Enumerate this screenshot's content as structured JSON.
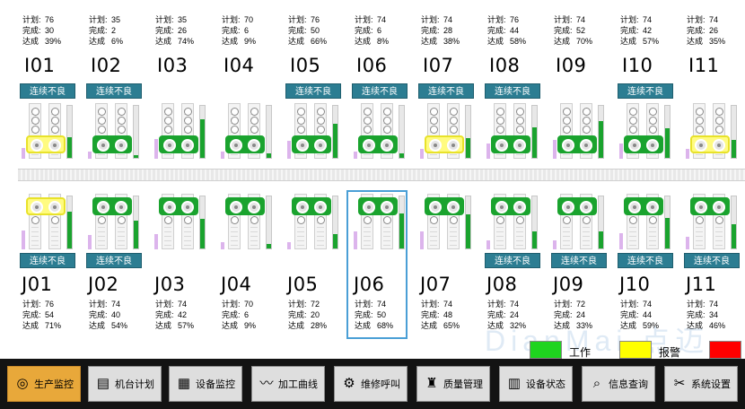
{
  "stat_keys": {
    "plan": "计划:",
    "done": "完成:",
    "rate": "达成"
  },
  "defect_label": "连续不良",
  "top_stations": [
    {
      "id": "I01",
      "plan": "76",
      "done": "30",
      "rate": "39%",
      "defect": true,
      "holder": "yellow",
      "fill": 0.39
    },
    {
      "id": "I02",
      "plan": "35",
      "done": "2",
      "rate": "6%",
      "defect": true,
      "holder": "green",
      "fill": 0.06
    },
    {
      "id": "I03",
      "plan": "35",
      "done": "26",
      "rate": "74%",
      "defect": false,
      "holder": "green",
      "fill": 0.74
    },
    {
      "id": "I04",
      "plan": "70",
      "done": "6",
      "rate": "9%",
      "defect": false,
      "holder": "green",
      "fill": 0.09
    },
    {
      "id": "I05",
      "plan": "76",
      "done": "50",
      "rate": "66%",
      "defect": true,
      "holder": "green",
      "fill": 0.66
    },
    {
      "id": "I06",
      "plan": "74",
      "done": "6",
      "rate": "8%",
      "defect": true,
      "holder": "green",
      "fill": 0.08
    },
    {
      "id": "I07",
      "plan": "74",
      "done": "28",
      "rate": "38%",
      "defect": true,
      "holder": "yellow",
      "fill": 0.38
    },
    {
      "id": "I08",
      "plan": "76",
      "done": "44",
      "rate": "58%",
      "defect": true,
      "holder": "green",
      "fill": 0.58
    },
    {
      "id": "I09",
      "plan": "74",
      "done": "52",
      "rate": "70%",
      "defect": false,
      "holder": "green",
      "fill": 0.7
    },
    {
      "id": "I10",
      "plan": "74",
      "done": "42",
      "rate": "57%",
      "defect": true,
      "holder": "green",
      "fill": 0.57
    },
    {
      "id": "I11",
      "plan": "74",
      "done": "26",
      "rate": "35%",
      "defect": false,
      "holder": "yellow",
      "fill": 0.35
    }
  ],
  "bottom_stations": [
    {
      "id": "J01",
      "plan": "76",
      "done": "54",
      "rate": "71%",
      "defect": true,
      "holder": "yellow",
      "fill": 0.71
    },
    {
      "id": "J02",
      "plan": "74",
      "done": "40",
      "rate": "54%",
      "defect": true,
      "holder": "green",
      "fill": 0.54
    },
    {
      "id": "J03",
      "plan": "74",
      "done": "42",
      "rate": "57%",
      "defect": false,
      "holder": "green",
      "fill": 0.57
    },
    {
      "id": "J04",
      "plan": "70",
      "done": "6",
      "rate": "9%",
      "defect": false,
      "holder": "green",
      "fill": 0.09
    },
    {
      "id": "J05",
      "plan": "72",
      "done": "20",
      "rate": "28%",
      "defect": false,
      "holder": "green",
      "fill": 0.28
    },
    {
      "id": "J06",
      "plan": "74",
      "done": "50",
      "rate": "68%",
      "defect": false,
      "holder": "green",
      "fill": 0.68
    },
    {
      "id": "J07",
      "plan": "74",
      "done": "48",
      "rate": "65%",
      "defect": false,
      "holder": "green",
      "fill": 0.65
    },
    {
      "id": "J08",
      "plan": "74",
      "done": "24",
      "rate": "32%",
      "defect": true,
      "holder": "green",
      "fill": 0.32
    },
    {
      "id": "J09",
      "plan": "72",
      "done": "24",
      "rate": "33%",
      "defect": true,
      "holder": "green",
      "fill": 0.33
    },
    {
      "id": "J10",
      "plan": "74",
      "done": "44",
      "rate": "59%",
      "defect": true,
      "holder": "green",
      "fill": 0.59
    },
    {
      "id": "J11",
      "plan": "74",
      "done": "34",
      "rate": "46%",
      "defect": true,
      "holder": "green",
      "fill": 0.46
    }
  ],
  "legend": {
    "work_label": "工作",
    "alarm_label": "报警",
    "work_color": "#1fd41f",
    "alarm_color": "#ffff00",
    "fault_color": "#ff0000"
  },
  "watermark": "DianMai 点迈",
  "taskbar": [
    {
      "label": "生产监控",
      "icon": "coils-icon",
      "active": true
    },
    {
      "label": "机台计划",
      "icon": "notebook-icon",
      "active": false
    },
    {
      "label": "设备监控",
      "icon": "monitor-chart-icon",
      "active": false
    },
    {
      "label": "加工曲线",
      "icon": "curve-chart-icon",
      "active": false
    },
    {
      "label": "维修呼叫",
      "icon": "gears-icon",
      "active": false
    },
    {
      "label": "质量管理",
      "icon": "worker-icon",
      "active": false
    },
    {
      "label": "设备状态",
      "icon": "cabinet-icon",
      "active": false
    },
    {
      "label": "信息查询",
      "icon": "magnifier-icon",
      "active": false
    },
    {
      "label": "系统设置",
      "icon": "tools-icon",
      "active": false
    }
  ]
}
